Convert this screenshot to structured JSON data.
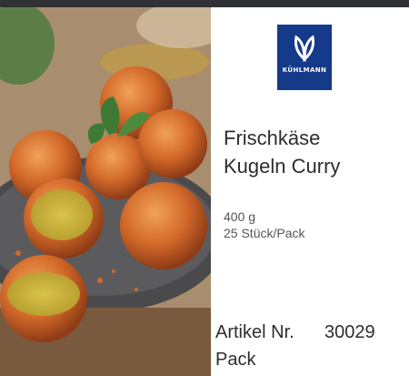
{
  "product": {
    "brand_logo_text": "KÜHLMANN",
    "name_line1": "Frischkäse",
    "name_line2": "Kugeln Curry",
    "weight": "400 g",
    "pieces": "25 Stück/Pack",
    "article_label": "Artikel Nr.",
    "article_number": "30029",
    "unit": "Pack"
  },
  "colors": {
    "logo_bg": "#163a8a",
    "card_bg": "#ffffff",
    "page_bg": "#2f3134"
  },
  "icons": {
    "brand": "leaf-logo-icon"
  }
}
